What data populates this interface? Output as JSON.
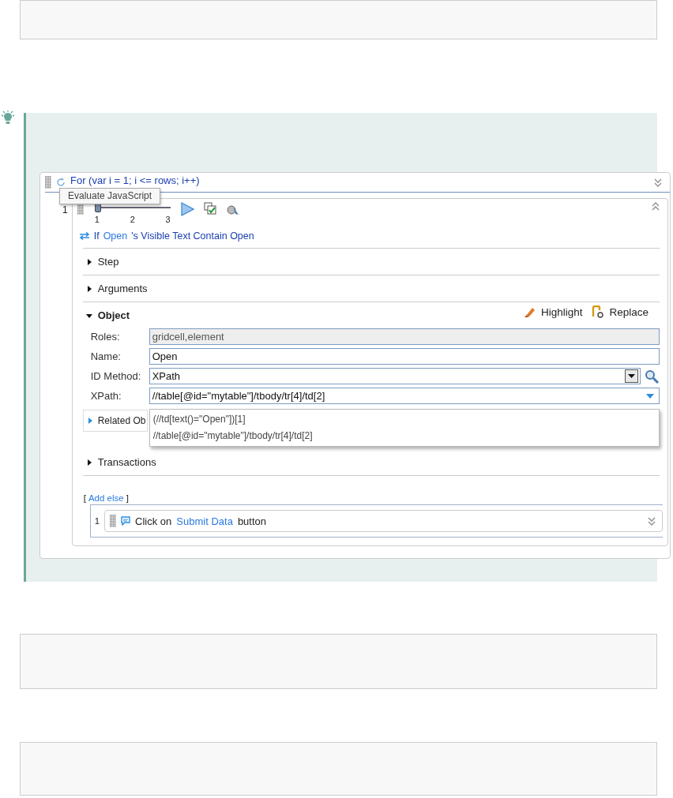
{
  "tip": {
    "kind": "tip"
  },
  "loop": {
    "title": "For (var i = 1; i <= rows; i++)",
    "tooltip": "Evaluate JavaScript",
    "number": "1"
  },
  "step": {
    "slider": {
      "level": 0,
      "ticks": [
        "1",
        "2",
        "3"
      ]
    },
    "condition": {
      "prefix": "If",
      "object": "Open",
      "text": "'s Visible Text Contain Open"
    },
    "sections": [
      {
        "label": "Step",
        "expanded": false
      },
      {
        "label": "Arguments",
        "expanded": false
      },
      {
        "label": "Object",
        "expanded": true
      }
    ],
    "actions": [
      "Highlight",
      "Replace"
    ],
    "fields": [
      {
        "label": "Roles:",
        "value": "gridcell,element",
        "kind": "readonly"
      },
      {
        "label": "Name:",
        "value": "Open",
        "kind": "text"
      },
      {
        "label": "ID Method:",
        "value": "XPath",
        "kind": "select"
      },
      {
        "label": "XPath:",
        "value": "//table[@id=\"mytable\"]/tbody/tr[4]/td[2]",
        "kind": "combo"
      }
    ],
    "options": [
      "(//td[text()=\"Open\"])[1]",
      "//table[@id=\"mytable\"]/tbody/tr[4]/td[2]"
    ],
    "related": {
      "label": "Related Ob",
      "expanded": false
    },
    "transactions": {
      "label": "Transactions",
      "expanded": false
    },
    "add_else": {
      "open": "[",
      "link": "Add else",
      "close": "]"
    },
    "else_steps": [
      {
        "number": "1",
        "action": "Click on",
        "object": "Submit Data",
        "suffix": "button"
      }
    ]
  }
}
